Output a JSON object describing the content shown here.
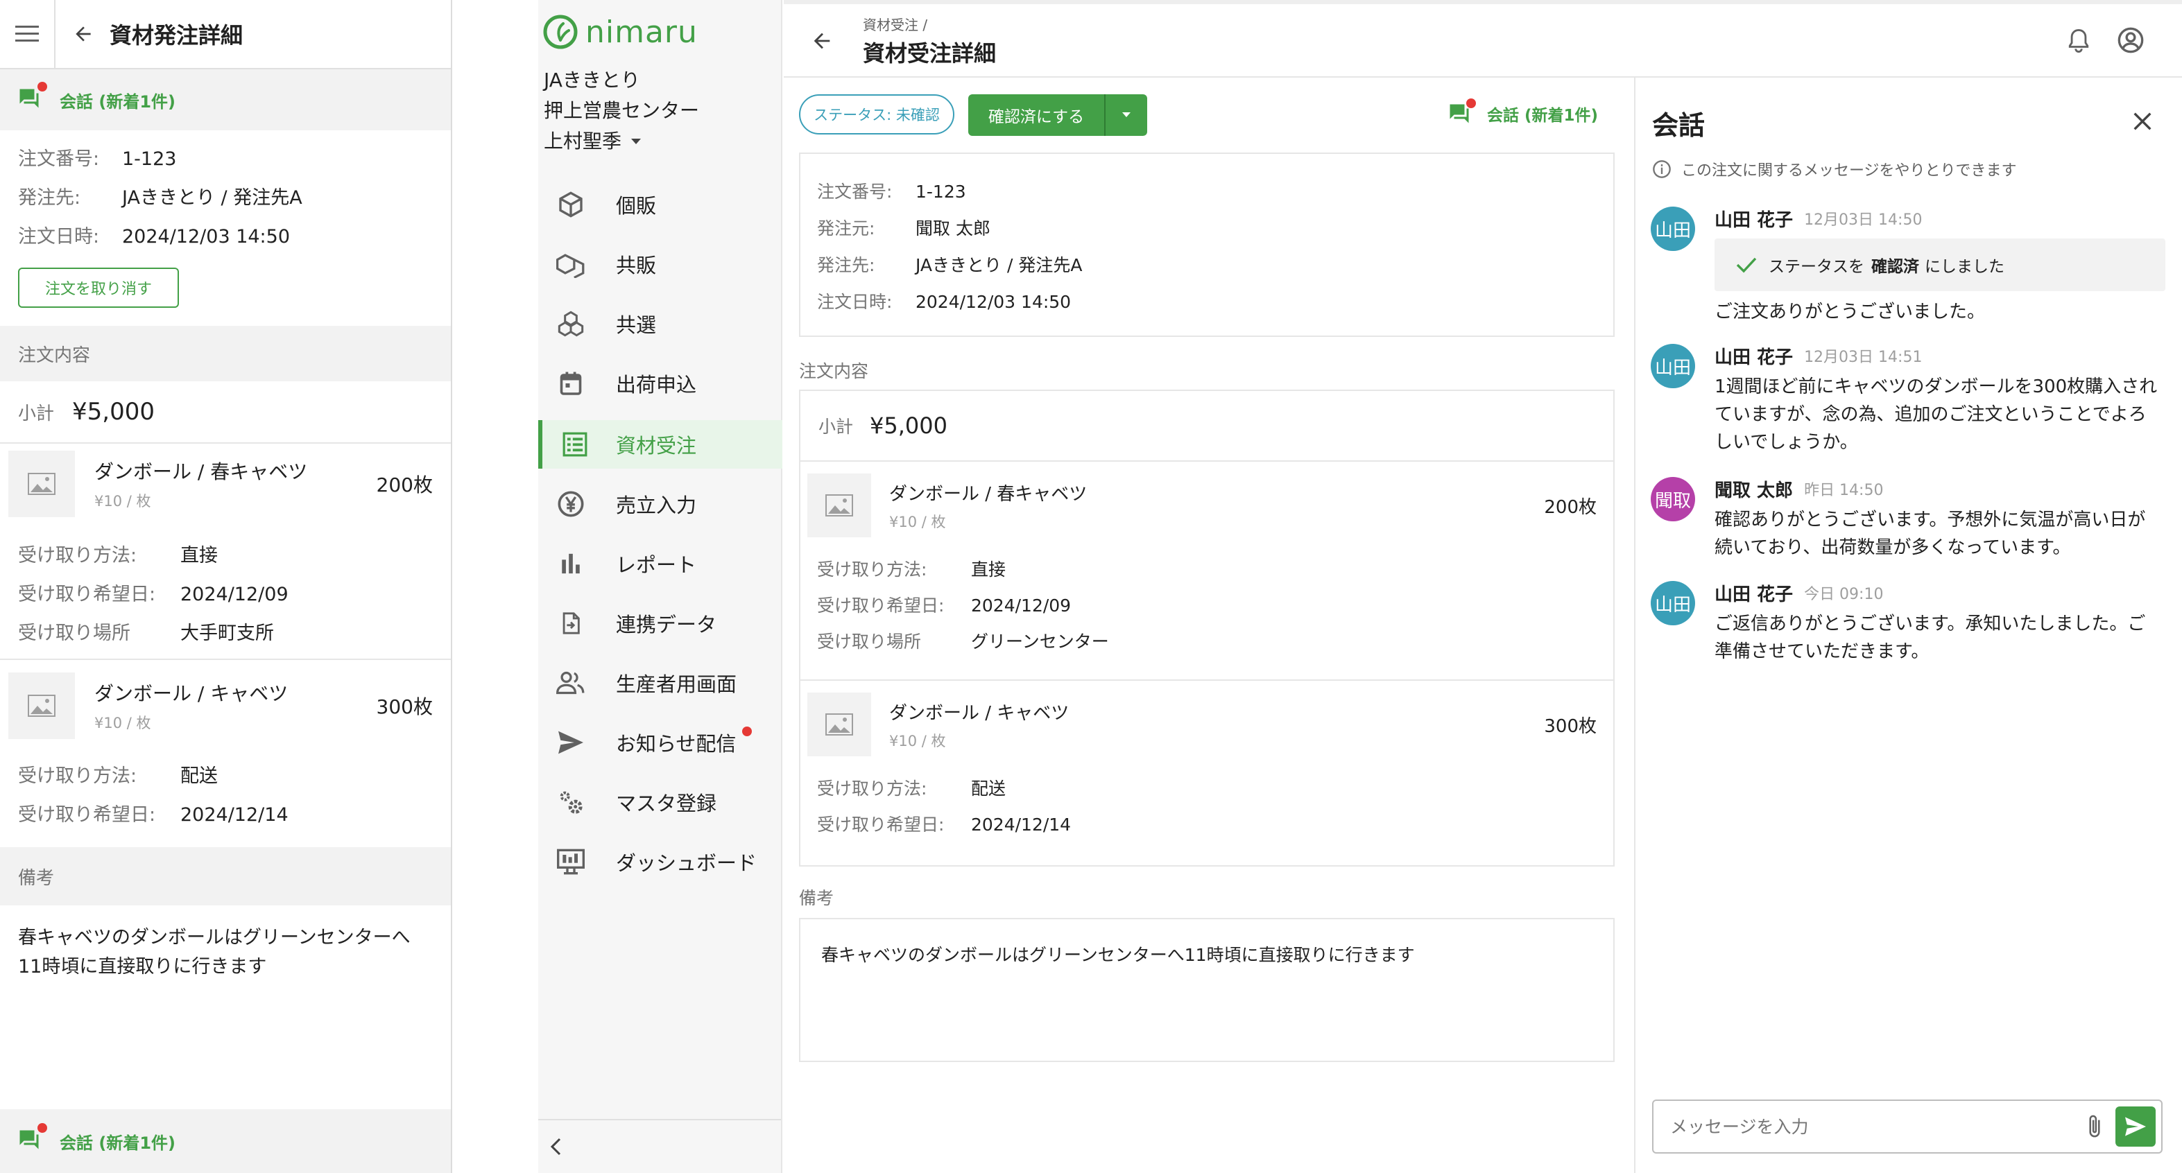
{
  "mobile": {
    "title": "資材発注詳細",
    "conversation_label": "会話 (新着1件)",
    "order_info": {
      "number_label": "注文番号:",
      "number": "1-123",
      "supplier_label": "発注先:",
      "supplier": "JAききとり / 発注先A",
      "date_label": "注文日時:",
      "date": "2024/12/03 14:50"
    },
    "cancel_button": "注文を取り消す",
    "section_order": "注文内容",
    "subtotal_label": "小計",
    "subtotal": "¥5,000",
    "items": [
      {
        "name": "ダンボール / 春キャベツ",
        "price": "¥10 / 枚",
        "qty": "200枚",
        "method_label": "受け取り方法:",
        "method": "直接",
        "date_label": "受け取り希望日:",
        "date": "2024/12/09",
        "place_label": "受け取り場所",
        "place": "大手町支所"
      },
      {
        "name": "ダンボール / キャベツ",
        "price": "¥10 / 枚",
        "qty": "300枚",
        "method_label": "受け取り方法:",
        "method": "配送",
        "date_label": "受け取り希望日:",
        "date": "2024/12/14"
      }
    ],
    "section_notes": "備考",
    "notes": "春キャベツのダンボールはグリーンセンターへ11時頃に直接取りに行きます",
    "bottom_conversation_label": "会話 (新着1件)"
  },
  "sidebar": {
    "logo_text": "nimaru",
    "org_line1": "JAききとり",
    "org_line2": "押上営農センター",
    "user": "上村聖季",
    "items": [
      {
        "label": "個販",
        "icon": "box-icon"
      },
      {
        "label": "共販",
        "icon": "boxes-icon"
      },
      {
        "label": "共選",
        "icon": "stack-icon"
      },
      {
        "label": "出荷申込",
        "icon": "calendar-icon"
      },
      {
        "label": "資材受注",
        "icon": "list-icon",
        "active": true
      },
      {
        "label": "売立入力",
        "icon": "yen-icon"
      },
      {
        "label": "レポート",
        "icon": "bar-chart-icon"
      },
      {
        "label": "連携データ",
        "icon": "file-import-icon"
      },
      {
        "label": "生産者用画面",
        "icon": "people-icon"
      },
      {
        "label": "お知らせ配信",
        "icon": "send-icon",
        "badge": true
      },
      {
        "label": "マスタ登録",
        "icon": "gears-icon"
      },
      {
        "label": "ダッシュボード",
        "icon": "monitor-icon"
      }
    ]
  },
  "header": {
    "breadcrumb": "資材受注 /",
    "title": "資材受注詳細"
  },
  "toolbar": {
    "status_chip": "ステータス: 未確認",
    "confirm_button": "確認済にする",
    "conversation_label": "会話 (新着1件)"
  },
  "order": {
    "number_label": "注文番号:",
    "number": "1-123",
    "from_label": "発注元:",
    "from": "聞取 太郎",
    "to_label": "発注先:",
    "to": "JAききとり / 発注先A",
    "date_label": "注文日時:",
    "date": "2024/12/03 14:50"
  },
  "contents": {
    "section_label": "注文内容",
    "subtotal_label": "小計",
    "subtotal": "¥5,000",
    "items": [
      {
        "name": "ダンボール / 春キャベツ",
        "price": "¥10 / 枚",
        "qty": "200枚",
        "method_label": "受け取り方法:",
        "method": "直接",
        "date_label": "受け取り希望日:",
        "date": "2024/12/09",
        "place_label": "受け取り場所",
        "place": "グリーンセンター"
      },
      {
        "name": "ダンボール / キャベツ",
        "price": "¥10 / 枚",
        "qty": "300枚",
        "method_label": "受け取り方法:",
        "method": "配送",
        "date_label": "受け取り希望日:",
        "date": "2024/12/14"
      }
    ],
    "notes_label": "備考",
    "notes": "春キャベツのダンボールはグリーンセンターへ11時頃に直接取りに行きます"
  },
  "chat": {
    "title": "会話",
    "info": "この注文に関するメッセージをやりとりできます",
    "messages": [
      {
        "avatar": "山田",
        "name": "山田 花子",
        "time": "12月03日 14:50",
        "status_prefix": "ステータスを",
        "status_bold": "確認済",
        "status_suffix": "にしました",
        "text": "ご注文ありがとうございました。"
      },
      {
        "avatar": "山田",
        "name": "山田 花子",
        "time": "12月03日 14:51",
        "line1": "1週間ほど前にキャベツのダンボールを300枚購入され",
        "line2": "ていますが、念の為、追加のご注文ということでよろ",
        "line3": "しいでしょうか。"
      },
      {
        "avatar": "聞取",
        "name": "聞取 太郎",
        "time": "昨日 14:50",
        "line1": "確認ありがとうございます。予想外に気温が高い日が",
        "line2": "続いており、出荷数量が多くなっています。"
      },
      {
        "avatar": "山田",
        "name": "山田 花子",
        "time": "今日 09:10",
        "line1": "ご返信ありがとうございます。承知いたしました。ご",
        "line2": "準備させていただきます。"
      }
    ],
    "input_placeholder": "メッセージを入力"
  },
  "colors": {
    "brand_green": "#43a047",
    "avatar_teal": "#3a9fb8",
    "avatar_purple": "#b540a8",
    "badge_red": "#e53935"
  }
}
